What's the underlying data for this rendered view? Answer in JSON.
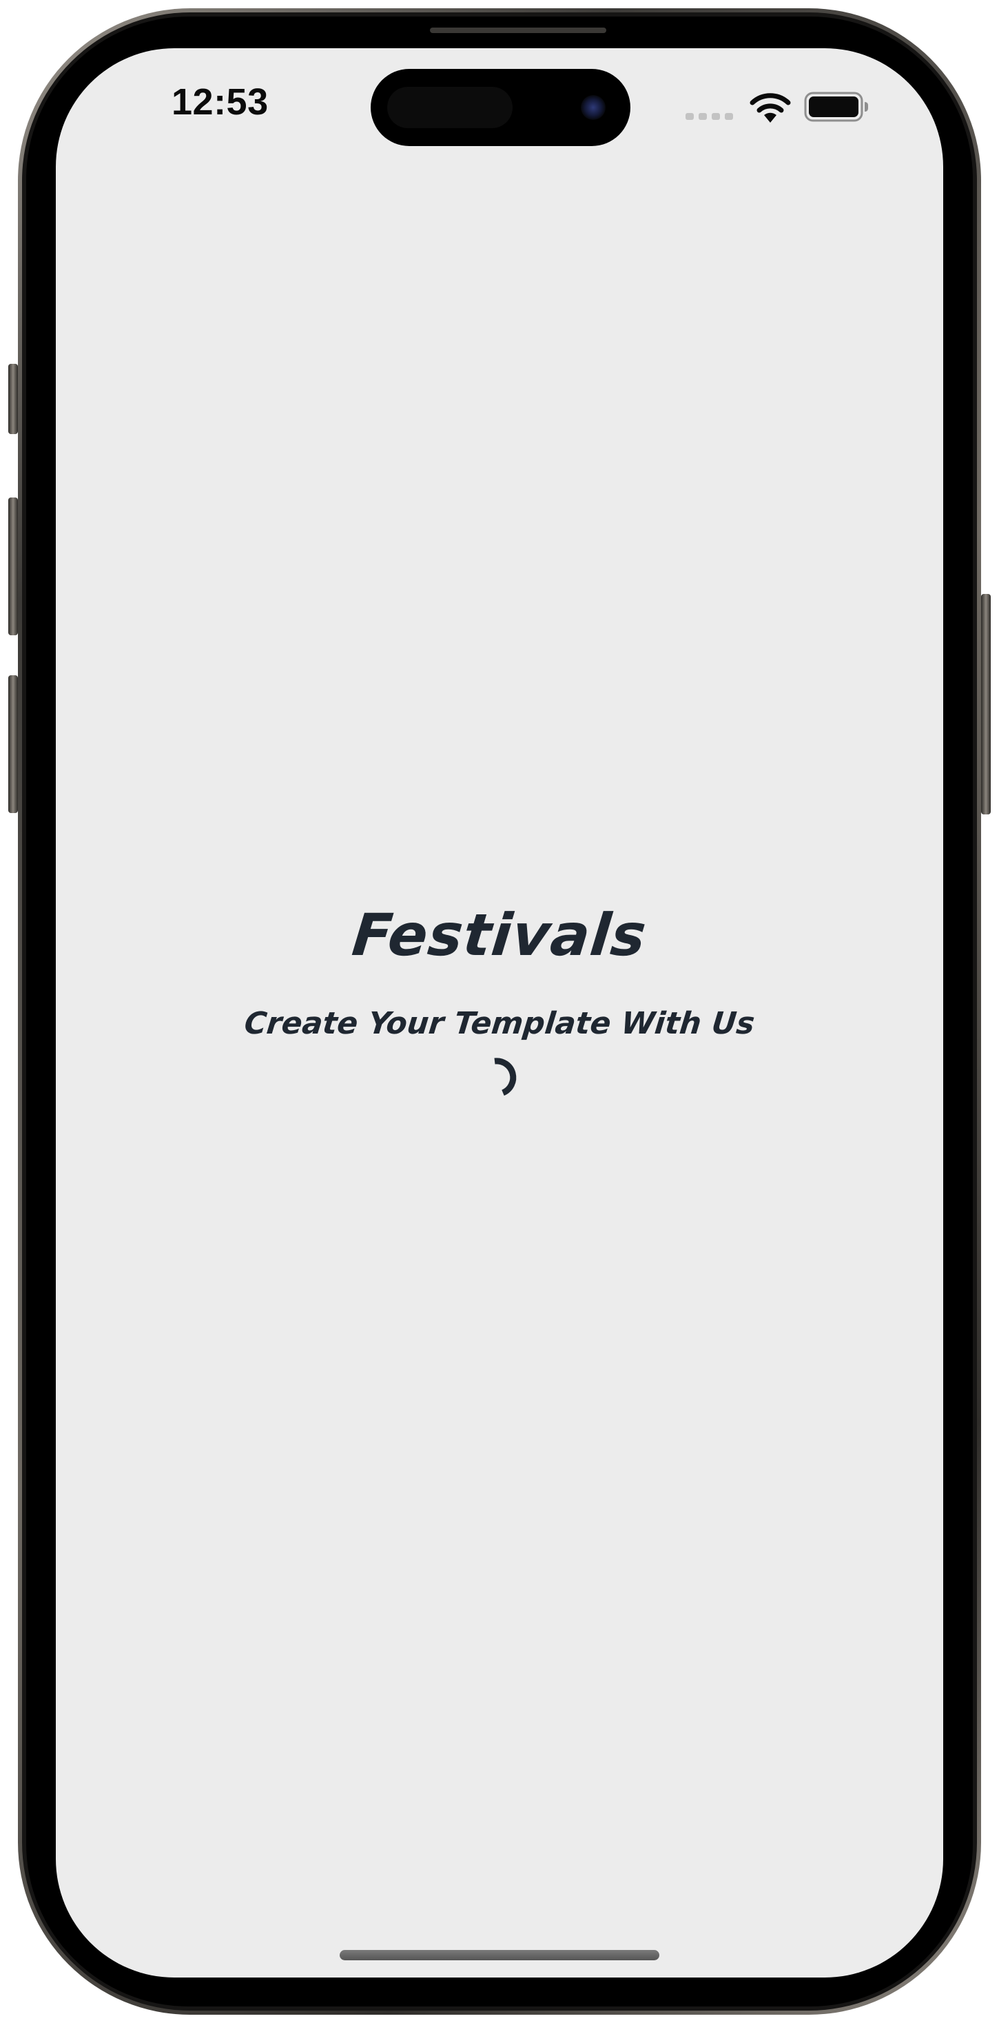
{
  "status_bar": {
    "time": "12:53"
  },
  "app": {
    "title": "Festivals",
    "subtitle": "Create Your Template With Us",
    "loading": true
  },
  "icons": {
    "signal": "signal-strength-icon",
    "wifi": "wifi-icon",
    "battery": "battery-icon",
    "spinner": "loading-spinner-icon"
  },
  "colors": {
    "screen_background": "#ececec",
    "text_primary": "#1f2731",
    "status_text": "#0b0b0b"
  }
}
